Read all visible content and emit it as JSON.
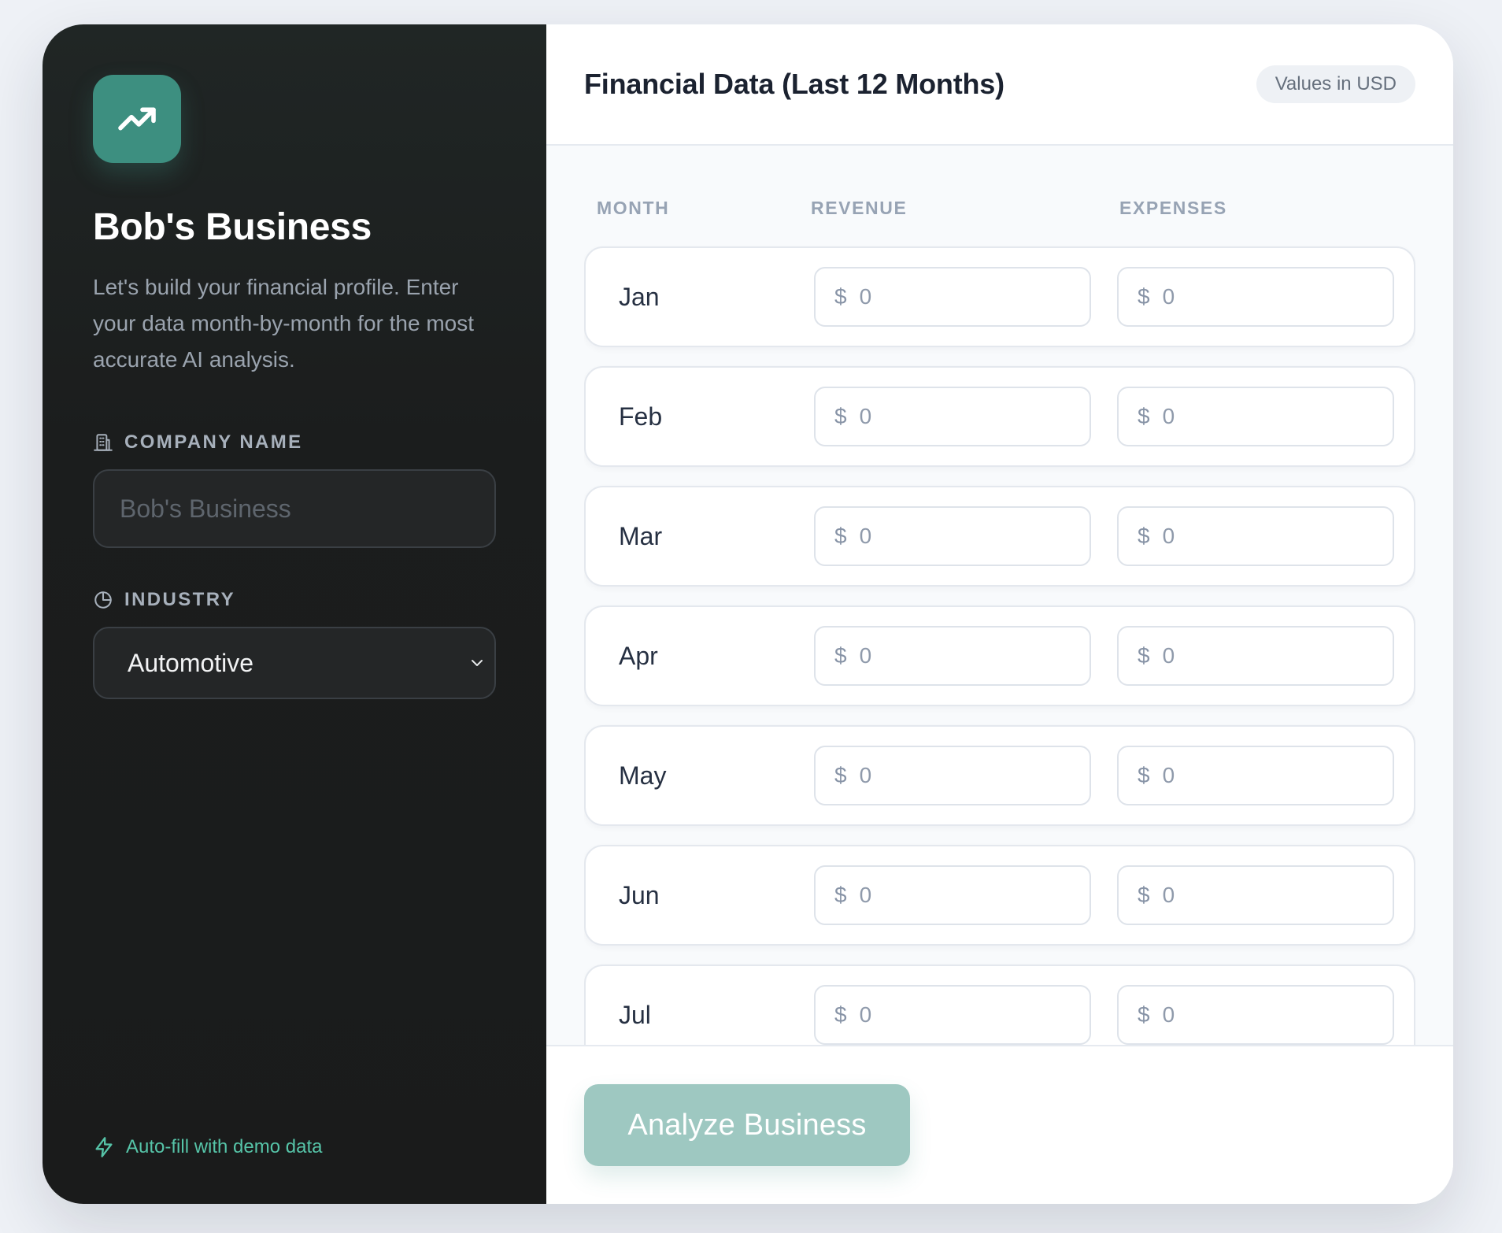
{
  "sidebar": {
    "title": "Bob's Business",
    "description": "Let's build your financial profile. Enter your data month-by-month for the most accurate AI analysis.",
    "company_label": "COMPANY NAME",
    "company_placeholder": "Bob's Business",
    "company_value": "",
    "industry_label": "INDUSTRY",
    "industry_selected": "Automotive",
    "autofill_label": "Auto-fill with demo data",
    "icons": {
      "logo": "trending-up-icon",
      "company": "building-icon",
      "industry": "pie-chart-icon",
      "select": "chevron-down-icon",
      "autofill": "lightning-icon"
    }
  },
  "main": {
    "title": "Financial Data (Last 12 Months)",
    "badge": "Values in USD",
    "columns": {
      "month": "MONTH",
      "revenue": "REVENUE",
      "expenses": "EXPENSES"
    },
    "currency_symbol": "$",
    "rows": [
      {
        "month": "Jan",
        "revenue": "0",
        "expenses": "0"
      },
      {
        "month": "Feb",
        "revenue": "0",
        "expenses": "0"
      },
      {
        "month": "Mar",
        "revenue": "0",
        "expenses": "0"
      },
      {
        "month": "Apr",
        "revenue": "0",
        "expenses": "0"
      },
      {
        "month": "May",
        "revenue": "0",
        "expenses": "0"
      },
      {
        "month": "Jun",
        "revenue": "0",
        "expenses": "0"
      },
      {
        "month": "Jul",
        "revenue": "0",
        "expenses": "0"
      }
    ],
    "analyze_button": "Analyze Business"
  },
  "colors": {
    "accent": "#3d8f80",
    "accent_disabled": "#9ec8c1",
    "sidebar_bg": "#1a1b1b",
    "autofill_link": "#56c4a8"
  }
}
